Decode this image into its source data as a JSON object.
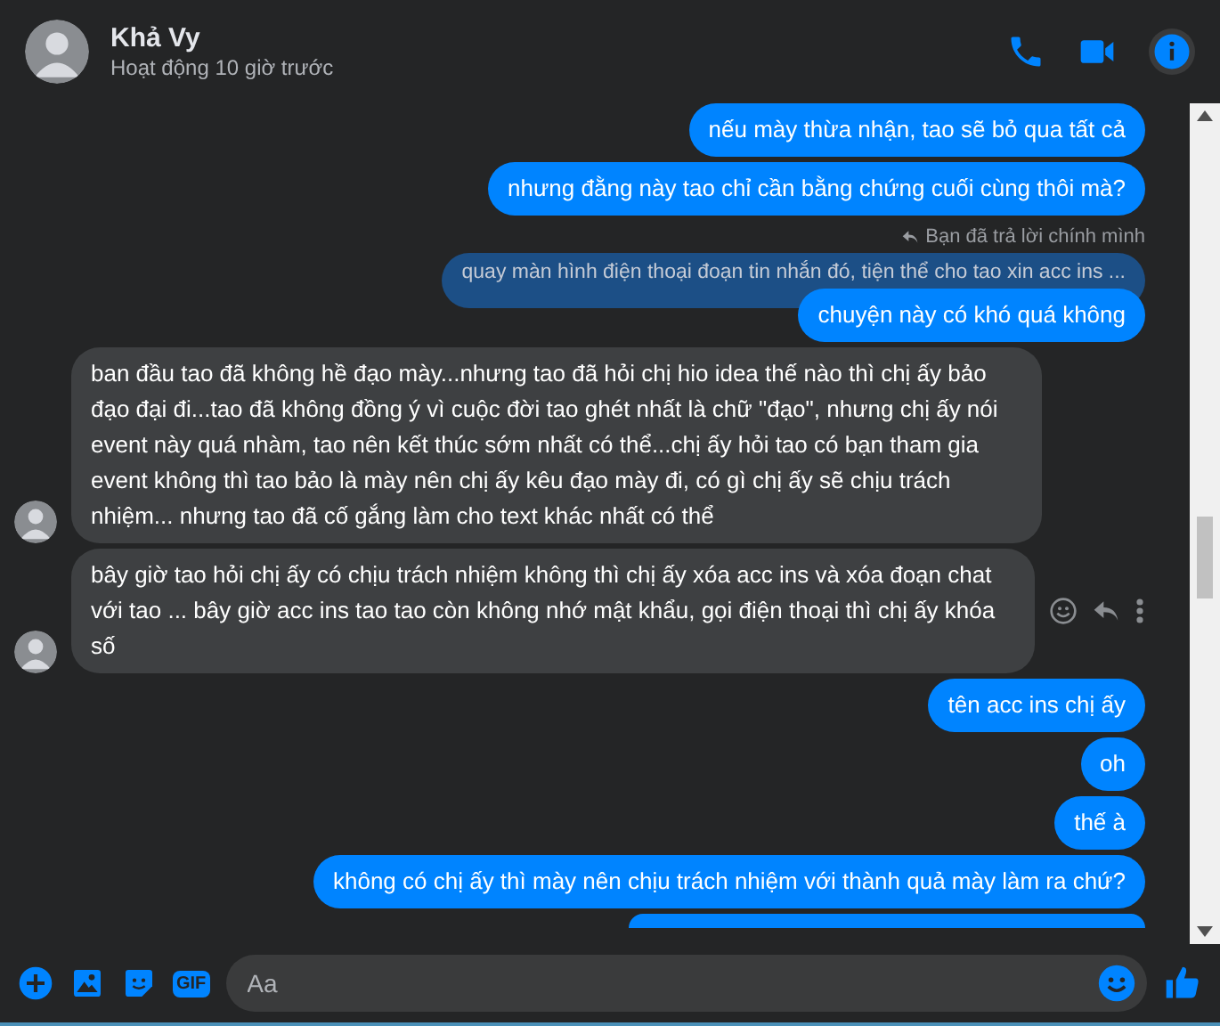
{
  "header": {
    "name": "Khả Vy",
    "status": "Hoạt động 10 giờ trước"
  },
  "messages": [
    {
      "kind": "sent",
      "text": "nếu mày thừa nhận, tao sẽ bỏ qua tất cả"
    },
    {
      "kind": "sent",
      "text": "nhưng đằng này tao chỉ cần bằng chứng cuối cùng thôi mà?"
    },
    {
      "kind": "reply_note",
      "text": "Bạn đã trả lời chính mình"
    },
    {
      "kind": "quoted",
      "text": "quay màn hình điện thoại đoạn tin nhắn đó, tiện thể cho tao xin acc ins ..."
    },
    {
      "kind": "sent",
      "text": "chuyện này có khó quá không"
    },
    {
      "kind": "received",
      "actions": false,
      "text": "ban đầu tao đã không hề đạo mày...nhưng tao đã hỏi chị hio idea thế nào thì chị ấy bảo đạo đại đi...tao đã không đồng ý vì cuộc đời tao ghét nhất là chữ \"đạo\", nhưng chị ấy nói event này quá nhàm, tao nên kết thúc sớm nhất có thể...chị ấy hỏi tao có bạn tham gia event không thì tao bảo là mày nên chị ấy kêu đạo mày đi, có gì chị ấy sẽ chịu trách nhiệm... nhưng tao đã cố gắng làm cho text khác nhất có thể"
    },
    {
      "kind": "received",
      "actions": true,
      "text": "bây giờ tao hỏi chị ấy có chịu trách nhiệm không thì chị ấy xóa acc ins và xóa đoạn chat với tao ... bây giờ acc ins tao tao còn không nhớ mật khẩu, gọi điện thoại thì chị ấy khóa số"
    },
    {
      "kind": "sent",
      "text": "tên acc ins chị ấy"
    },
    {
      "kind": "sent",
      "text": "oh"
    },
    {
      "kind": "sent",
      "text": "thế à"
    },
    {
      "kind": "sent",
      "text": "không có chị ấy thì mày nên chịu trách nhiệm với thành quả mày làm ra chứ?"
    },
    {
      "kind": "partial"
    }
  ],
  "composer": {
    "gif_label": "GIF",
    "placeholder": "Aa"
  }
}
